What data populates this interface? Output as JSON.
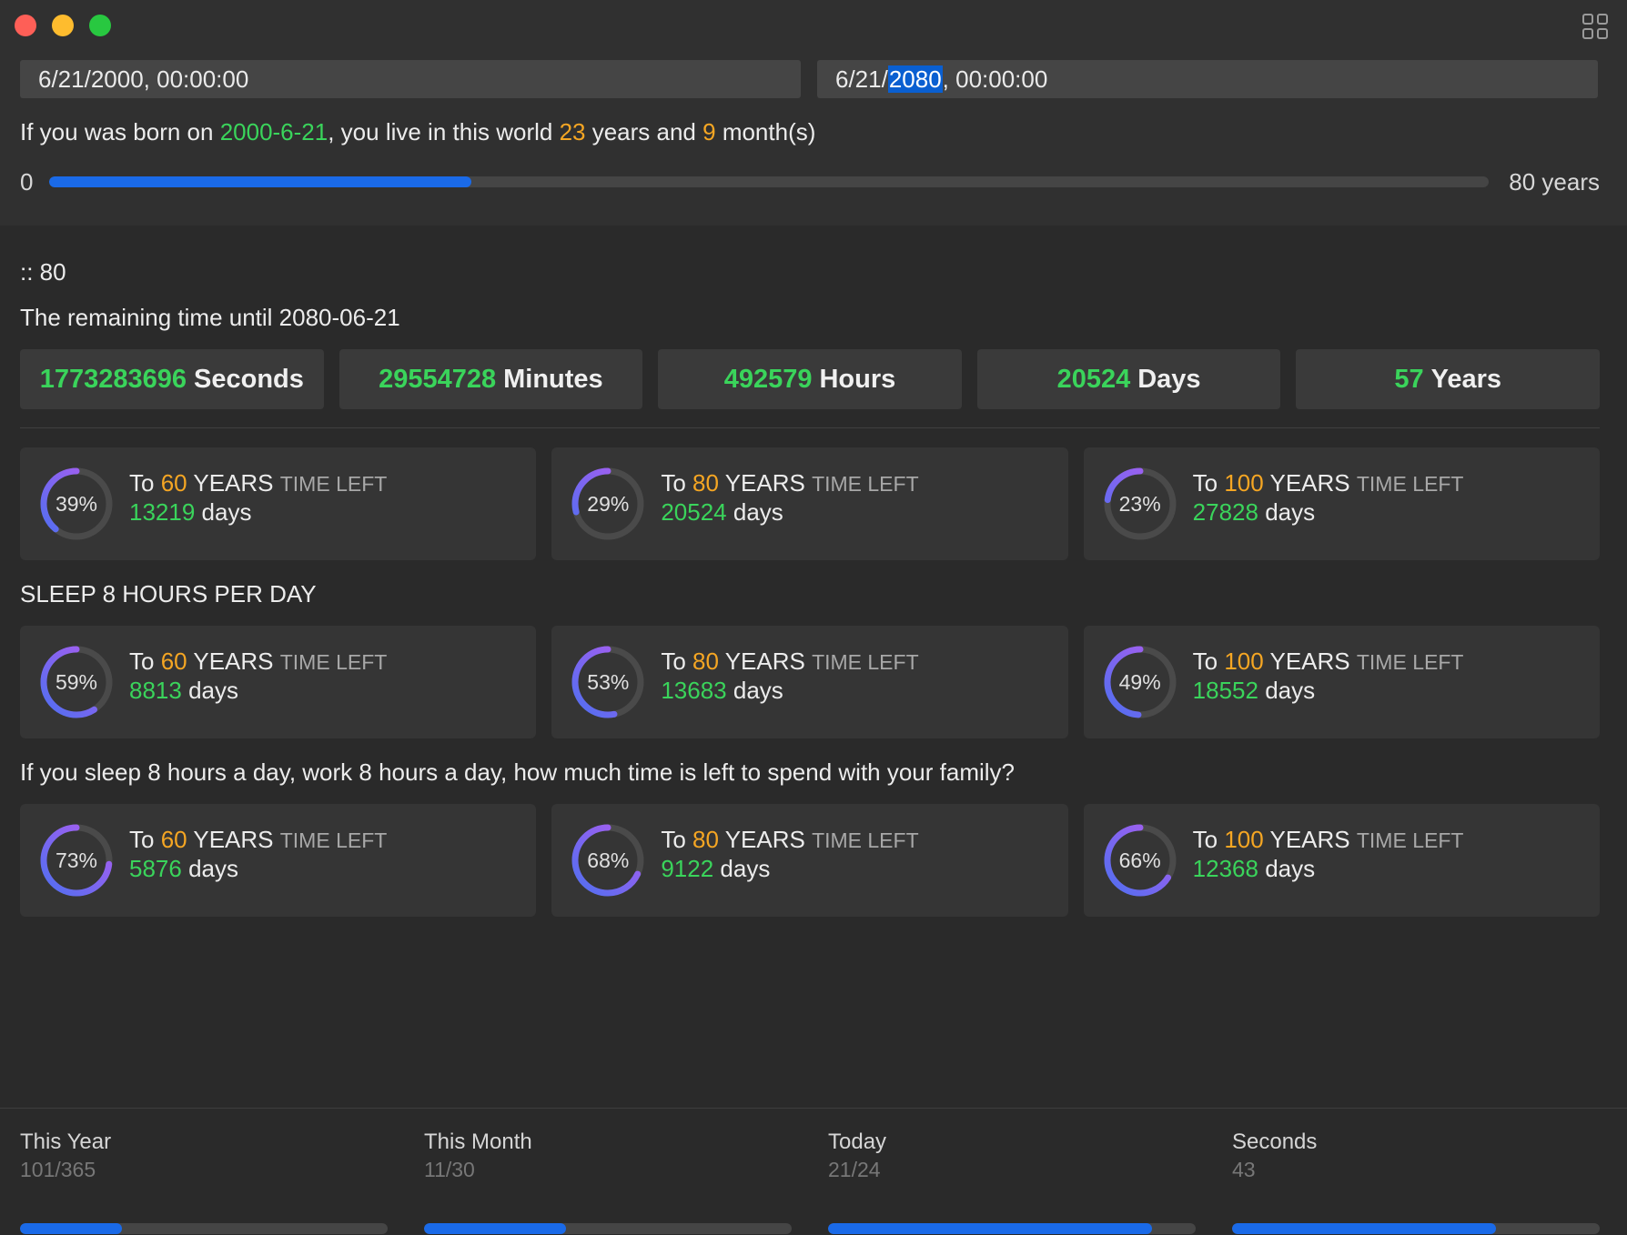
{
  "header": {
    "birth_date_value": "6/21/2000, 00:00:00",
    "target_date_prefix": "6/21/",
    "target_date_selected": "2080",
    "target_date_suffix": ", 00:00:00"
  },
  "born_sentence": {
    "part1": "If you was born on ",
    "birth_date": "2000-6-21",
    "part2": ", you live in this world ",
    "years": "23",
    "part3": " years and ",
    "months": "9",
    "part4": " month(s)"
  },
  "life_progress": {
    "min_label": "0",
    "max_label": "80 years",
    "fraction": 0.293
  },
  "target_heading": ":: 80",
  "remaining_text": "The remaining time until 2080-06-21",
  "stats": [
    {
      "value": "1773283696",
      "unit": "Seconds"
    },
    {
      "value": "29554728",
      "unit": "Minutes"
    },
    {
      "value": "492579",
      "unit": "Hours"
    },
    {
      "value": "20524",
      "unit": "Days"
    },
    {
      "value": "57",
      "unit": "Years"
    }
  ],
  "card_labels": {
    "to": "To ",
    "years": " YEARS ",
    "time_left": "TIME LEFT",
    "days": " days"
  },
  "groups": {
    "total": [
      {
        "age": "60",
        "percent": "39%",
        "fraction": 0.39,
        "days": "13219"
      },
      {
        "age": "80",
        "percent": "29%",
        "fraction": 0.29,
        "days": "20524"
      },
      {
        "age": "100",
        "percent": "23%",
        "fraction": 0.23,
        "days": "27828"
      }
    ],
    "sleep_title": "SLEEP 8 HOURS PER DAY",
    "sleep": [
      {
        "age": "60",
        "percent": "59%",
        "fraction": 0.59,
        "days": "8813"
      },
      {
        "age": "80",
        "percent": "53%",
        "fraction": 0.53,
        "days": "13683"
      },
      {
        "age": "100",
        "percent": "49%",
        "fraction": 0.49,
        "days": "18552"
      }
    ],
    "family_title": "If you sleep 8 hours a day, work 8 hours a day, how much time is left to spend with your family?",
    "family": [
      {
        "age": "60",
        "percent": "73%",
        "fraction": 0.73,
        "days": "5876"
      },
      {
        "age": "80",
        "percent": "68%",
        "fraction": 0.68,
        "days": "9122"
      },
      {
        "age": "100",
        "percent": "66%",
        "fraction": 0.66,
        "days": "12368"
      }
    ]
  },
  "bottom": [
    {
      "title": "This Year",
      "value": "101/365",
      "fraction": 0.277
    },
    {
      "title": "This Month",
      "value": "11/30",
      "fraction": 0.385
    },
    {
      "title": "Today",
      "value": "21/24",
      "fraction": 0.88
    },
    {
      "title": "Seconds",
      "value": "43",
      "fraction": 0.717
    }
  ],
  "colors": {
    "accent_green": "#3ad45b",
    "accent_orange": "#f5a623",
    "progress_blue": "#1a6ae8",
    "ring_start": "#4f6ff0",
    "ring_end": "#b05cf0"
  }
}
